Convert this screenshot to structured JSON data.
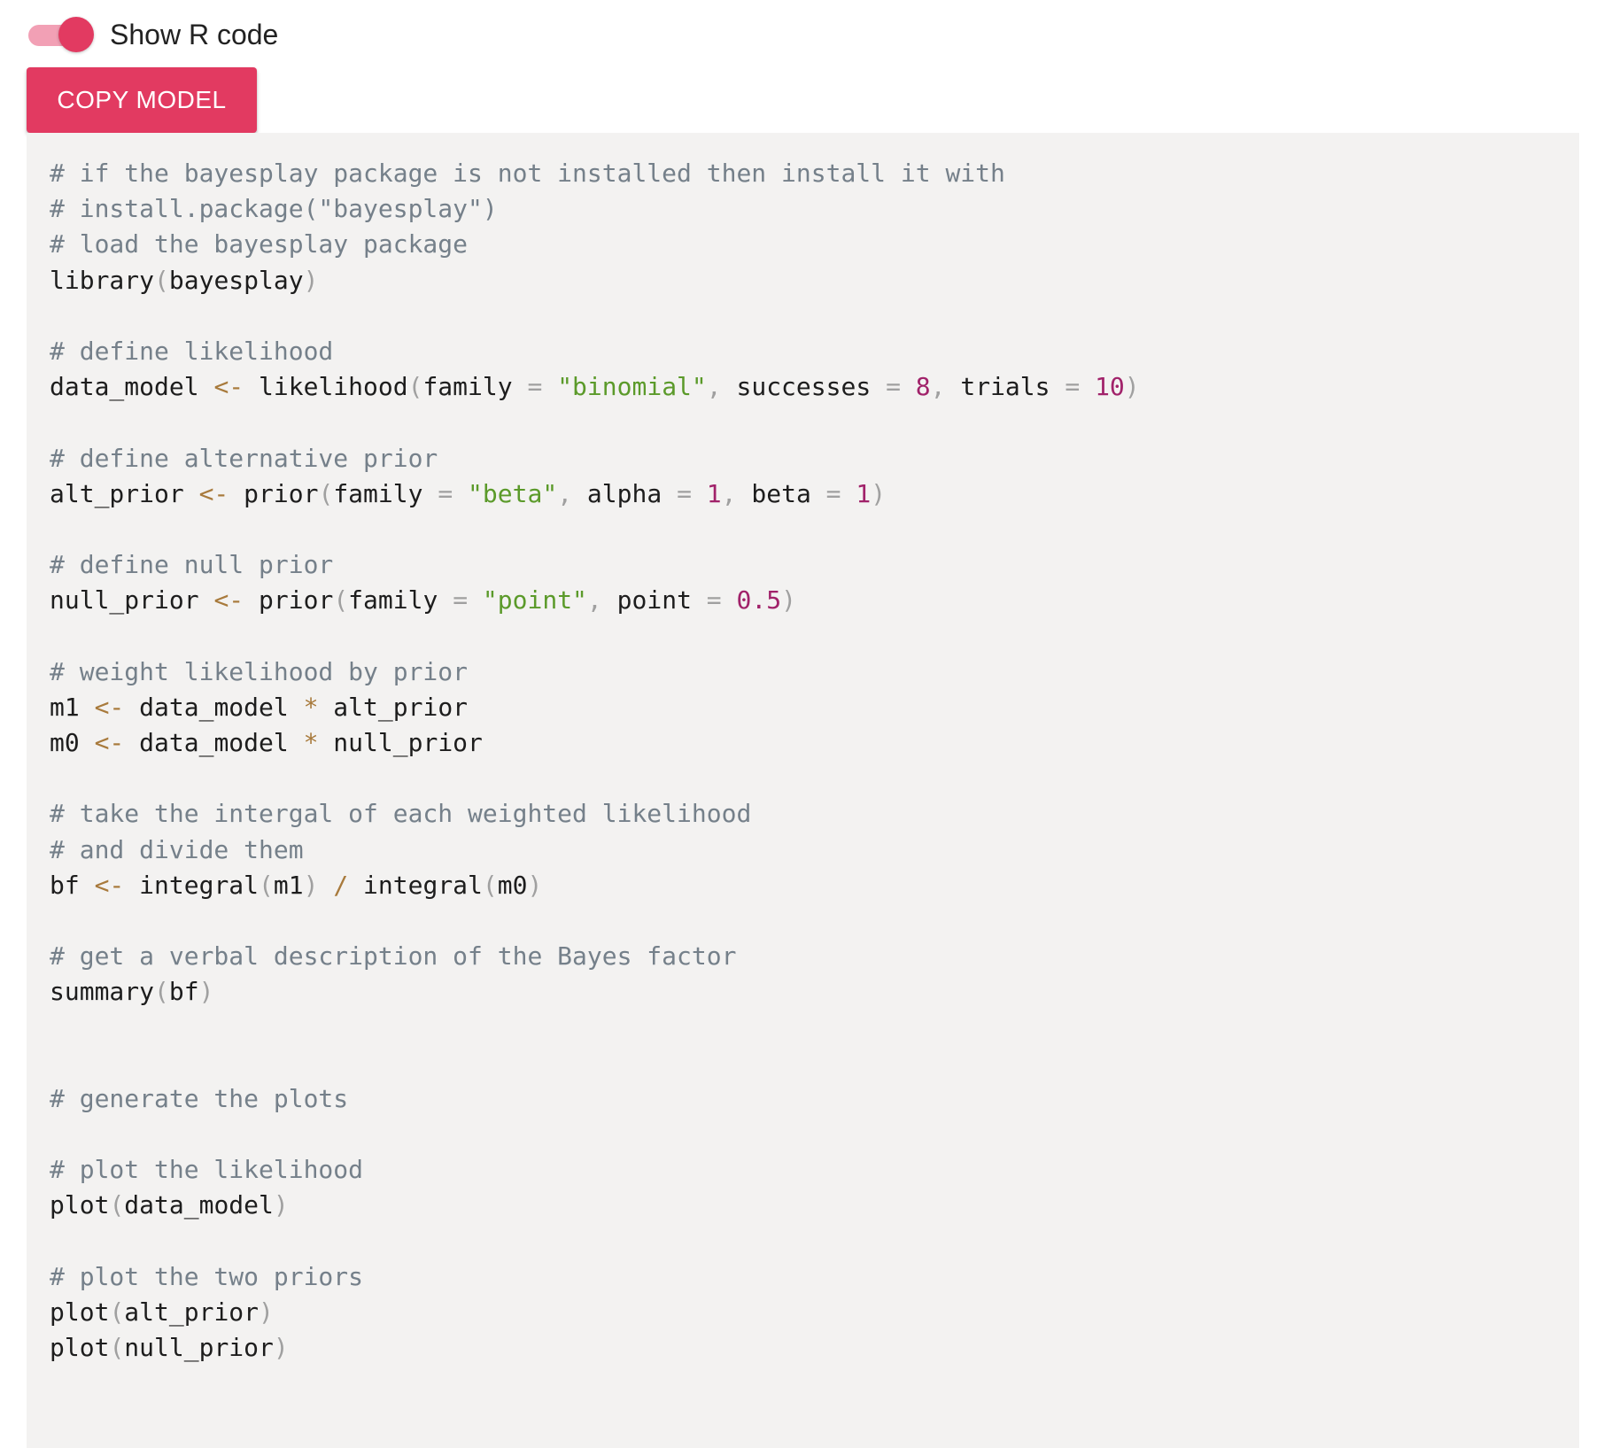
{
  "theme": {
    "accent": "#e23a61",
    "track": "#f2a0b5",
    "code_background": "#f3f2f1"
  },
  "toggle": {
    "label": "Show R code",
    "checked": true
  },
  "copy_button": {
    "label": "COPY MODEL"
  },
  "code_lines": [
    [
      [
        "comment",
        "# if the bayesplay package is not installed then install it with"
      ]
    ],
    [
      [
        "comment",
        "# install.package(\"bayesplay\")"
      ]
    ],
    [
      [
        "comment",
        "# load the bayesplay package"
      ]
    ],
    [
      [
        "plain",
        "library"
      ],
      [
        "punct",
        "("
      ],
      [
        "plain",
        "bayesplay"
      ],
      [
        "punct",
        ")"
      ]
    ],
    [],
    [
      [
        "comment",
        "# define likelihood"
      ]
    ],
    [
      [
        "plain",
        "data_model "
      ],
      [
        "op",
        "<-"
      ],
      [
        "plain",
        " likelihood"
      ],
      [
        "punct",
        "("
      ],
      [
        "plain",
        "family "
      ],
      [
        "punct",
        "="
      ],
      [
        "plain",
        " "
      ],
      [
        "string",
        "\"binomial\""
      ],
      [
        "punct",
        ","
      ],
      [
        "plain",
        " successes "
      ],
      [
        "punct",
        "="
      ],
      [
        "plain",
        " "
      ],
      [
        "number",
        "8"
      ],
      [
        "punct",
        ","
      ],
      [
        "plain",
        " trials "
      ],
      [
        "punct",
        "="
      ],
      [
        "plain",
        " "
      ],
      [
        "number",
        "10"
      ],
      [
        "punct",
        ")"
      ]
    ],
    [],
    [
      [
        "comment",
        "# define alternative prior"
      ]
    ],
    [
      [
        "plain",
        "alt_prior "
      ],
      [
        "op",
        "<-"
      ],
      [
        "plain",
        " prior"
      ],
      [
        "punct",
        "("
      ],
      [
        "plain",
        "family "
      ],
      [
        "punct",
        "="
      ],
      [
        "plain",
        " "
      ],
      [
        "string",
        "\"beta\""
      ],
      [
        "punct",
        ","
      ],
      [
        "plain",
        " alpha "
      ],
      [
        "punct",
        "="
      ],
      [
        "plain",
        " "
      ],
      [
        "number",
        "1"
      ],
      [
        "punct",
        ","
      ],
      [
        "plain",
        " beta "
      ],
      [
        "punct",
        "="
      ],
      [
        "plain",
        " "
      ],
      [
        "number",
        "1"
      ],
      [
        "punct",
        ")"
      ]
    ],
    [],
    [
      [
        "comment",
        "# define null prior"
      ]
    ],
    [
      [
        "plain",
        "null_prior "
      ],
      [
        "op",
        "<-"
      ],
      [
        "plain",
        " prior"
      ],
      [
        "punct",
        "("
      ],
      [
        "plain",
        "family "
      ],
      [
        "punct",
        "="
      ],
      [
        "plain",
        " "
      ],
      [
        "string",
        "\"point\""
      ],
      [
        "punct",
        ","
      ],
      [
        "plain",
        " point "
      ],
      [
        "punct",
        "="
      ],
      [
        "plain",
        " "
      ],
      [
        "number",
        "0.5"
      ],
      [
        "punct",
        ")"
      ]
    ],
    [],
    [
      [
        "comment",
        "# weight likelihood by prior"
      ]
    ],
    [
      [
        "plain",
        "m1 "
      ],
      [
        "op",
        "<-"
      ],
      [
        "plain",
        " data_model "
      ],
      [
        "op",
        "*"
      ],
      [
        "plain",
        " alt_prior"
      ]
    ],
    [
      [
        "plain",
        "m0 "
      ],
      [
        "op",
        "<-"
      ],
      [
        "plain",
        " data_model "
      ],
      [
        "op",
        "*"
      ],
      [
        "plain",
        " null_prior"
      ]
    ],
    [],
    [
      [
        "comment",
        "# take the intergal of each weighted likelihood"
      ]
    ],
    [
      [
        "comment",
        "# and divide them"
      ]
    ],
    [
      [
        "plain",
        "bf "
      ],
      [
        "op",
        "<-"
      ],
      [
        "plain",
        " integral"
      ],
      [
        "punct",
        "("
      ],
      [
        "plain",
        "m1"
      ],
      [
        "punct",
        ")"
      ],
      [
        "plain",
        " "
      ],
      [
        "op",
        "/"
      ],
      [
        "plain",
        " integral"
      ],
      [
        "punct",
        "("
      ],
      [
        "plain",
        "m0"
      ],
      [
        "punct",
        ")"
      ]
    ],
    [],
    [
      [
        "comment",
        "# get a verbal description of the Bayes factor"
      ]
    ],
    [
      [
        "plain",
        "summary"
      ],
      [
        "punct",
        "("
      ],
      [
        "plain",
        "bf"
      ],
      [
        "punct",
        ")"
      ]
    ],
    [],
    [],
    [
      [
        "comment",
        "# generate the plots"
      ]
    ],
    [],
    [
      [
        "comment",
        "# plot the likelihood"
      ]
    ],
    [
      [
        "plain",
        "plot"
      ],
      [
        "punct",
        "("
      ],
      [
        "plain",
        "data_model"
      ],
      [
        "punct",
        ")"
      ]
    ],
    [],
    [
      [
        "comment",
        "# plot the two priors"
      ]
    ],
    [
      [
        "plain",
        "plot"
      ],
      [
        "punct",
        "("
      ],
      [
        "plain",
        "alt_prior"
      ],
      [
        "punct",
        ")"
      ]
    ],
    [
      [
        "plain",
        "plot"
      ],
      [
        "punct",
        "("
      ],
      [
        "plain",
        "null_prior"
      ],
      [
        "punct",
        ")"
      ]
    ]
  ]
}
